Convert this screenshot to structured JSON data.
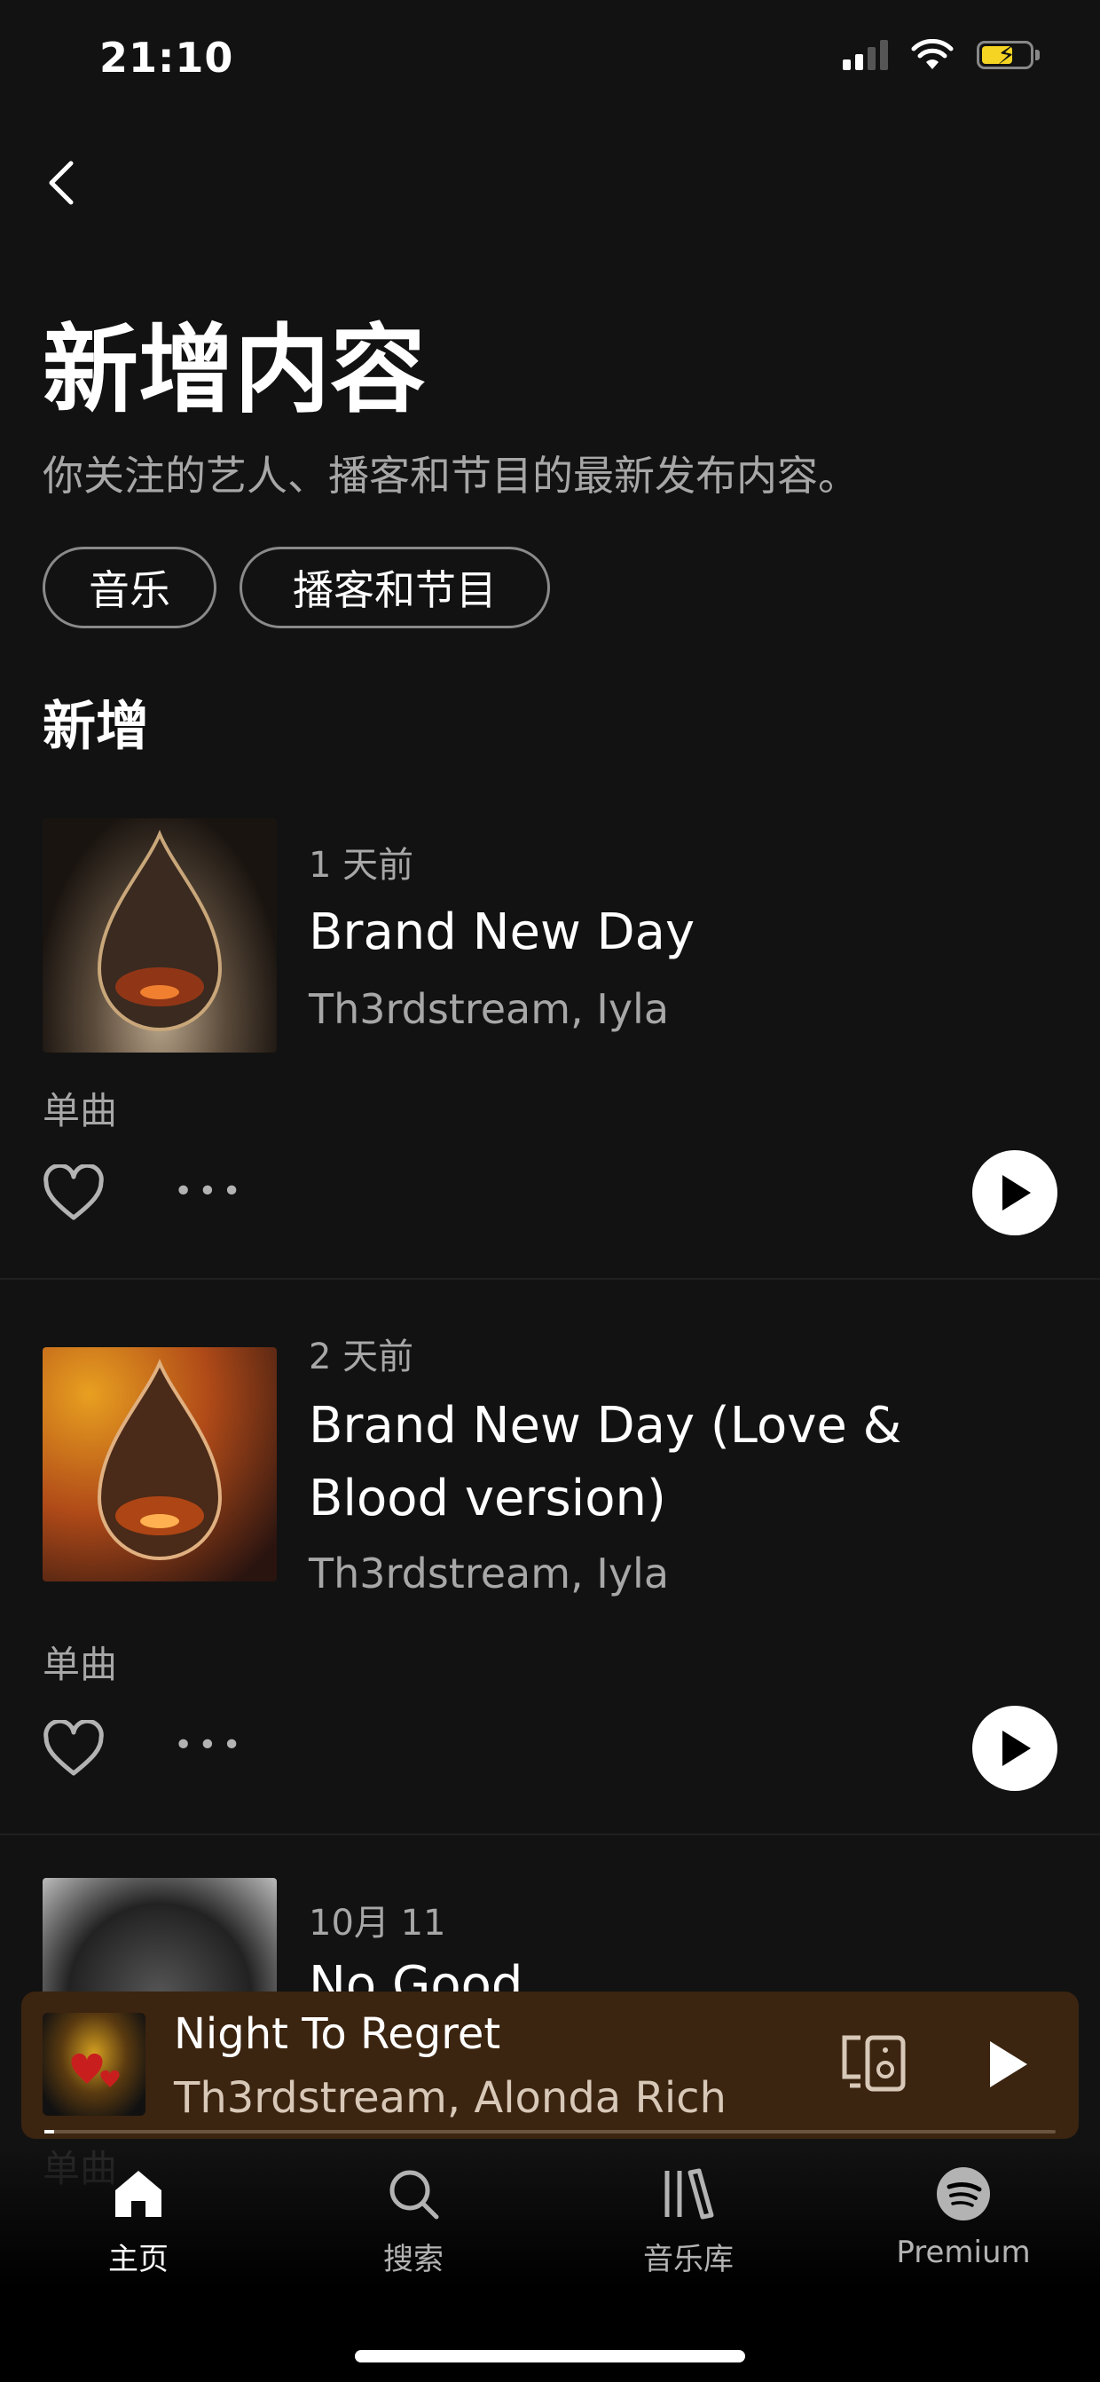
{
  "status_bar": {
    "time": "21:10"
  },
  "header": {
    "title": "新增内容",
    "subtitle": "你关注的艺人、播客和节目的最新发布内容。"
  },
  "filters": [
    {
      "label": "音乐"
    },
    {
      "label": "播客和节目"
    }
  ],
  "section": {
    "title": "新增"
  },
  "items": [
    {
      "date": "1 天前",
      "title": "Brand New Day",
      "artists": "Th3rdstream, Iyla",
      "type": "单曲"
    },
    {
      "date": "2 天前",
      "title": "Brand New Day (Love & Blood version)",
      "artists": "Th3rdstream, Iyla",
      "type": "单曲"
    },
    {
      "date": "10月 11",
      "title": "No Good",
      "artists": "",
      "type": "单曲"
    }
  ],
  "mini_player": {
    "title": "Night To Regret",
    "artists": "Th3rdstream, Alonda Rich",
    "progress": 0.01
  },
  "tabs": [
    {
      "label": "主页",
      "icon": "home-icon",
      "active": true
    },
    {
      "label": "搜索",
      "icon": "search-icon",
      "active": false
    },
    {
      "label": "音乐库",
      "icon": "library-icon",
      "active": false
    },
    {
      "label": "Premium",
      "icon": "spotify-icon",
      "active": false
    }
  ],
  "colors": {
    "background": "#121212",
    "mini_player_bg": "#3b2410",
    "battery": "#f5d423"
  }
}
